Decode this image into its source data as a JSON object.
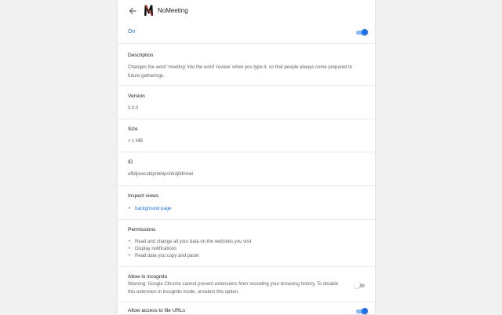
{
  "header": {
    "back_icon": "arrow-left-icon",
    "logo_text": "M",
    "name": "NoMeeting"
  },
  "enabled": {
    "label": "On",
    "state": true
  },
  "description": {
    "title": "Description",
    "text": "Changes the word 'meeting' into the word 'review' when you type it, so that people always come prepared to future gatherings."
  },
  "version": {
    "title": "Version",
    "value": "2.0.0"
  },
  "size": {
    "title": "Size",
    "value": "< 1 MB"
  },
  "id": {
    "title": "ID",
    "value": "efldijooicobipnbbipnhhdjifdhmei"
  },
  "inspect_views": {
    "title": "Inspect views",
    "items": [
      "background page"
    ]
  },
  "permissions": {
    "title": "Permissions",
    "items": [
      "Read and change all your data on the websites you visit",
      "Display notifications",
      "Read data you copy and paste"
    ]
  },
  "incognito": {
    "title": "Allow in incognito",
    "text": "Warning: Google Chrome cannot prevent extensions from recording your browsing history. To disable this extension in incognito mode, unselect this option.",
    "state": false
  },
  "file_urls": {
    "title": "Allow access to file URLs",
    "state": true
  },
  "colors": {
    "accent": "#1a73e8",
    "background": "#f1f1f1",
    "card": "#ffffff"
  }
}
